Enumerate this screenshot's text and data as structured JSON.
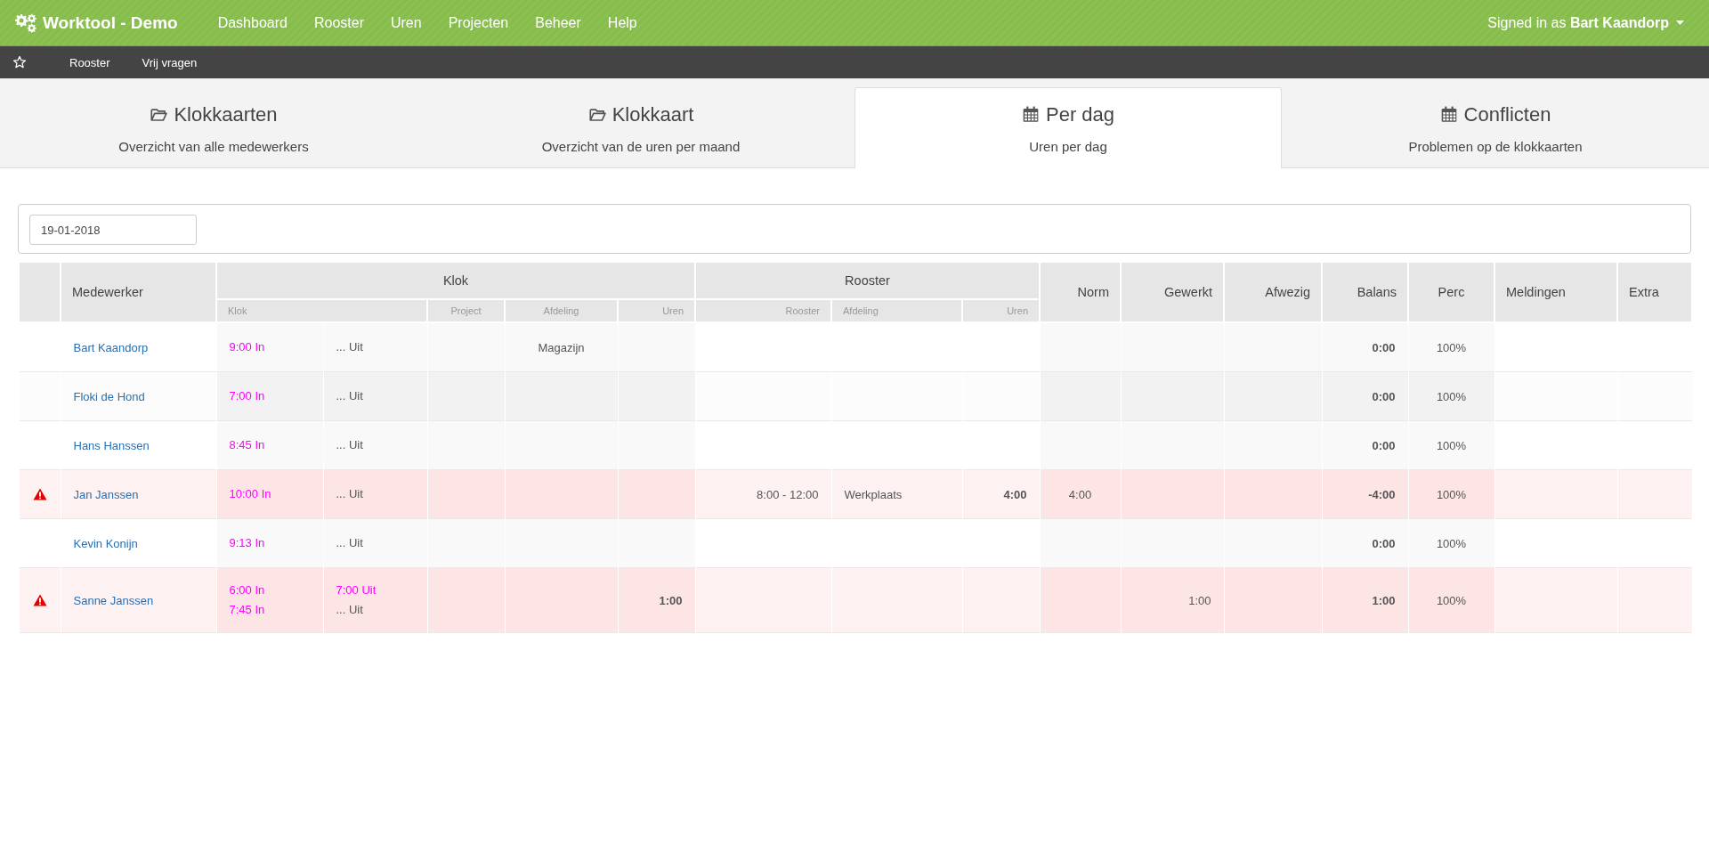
{
  "navbar": {
    "brand": "Worktool - Demo",
    "links": [
      "Dashboard",
      "Rooster",
      "Uren",
      "Projecten",
      "Beheer",
      "Help"
    ],
    "user": "Signed in as **Bart Kaandorp**"
  },
  "subnav": {
    "links": [
      "Rooster",
      "Vrij vragen"
    ]
  },
  "tabs": [
    {
      "title": "Klokkaarten",
      "subtitle": "Overzicht van alle medewerkers",
      "selected": false
    },
    {
      "title": "Klokkaart",
      "subtitle": "Overzicht van de uren per maand",
      "selected": false
    },
    {
      "title": "Per dag",
      "subtitle": "Uren per dag",
      "selected": true
    },
    {
      "title": "Conflicten",
      "subtitle": "Problemen op de klokkaarten",
      "selected": false
    }
  ],
  "date_field": {
    "value": "19-01-2018"
  },
  "table": {
    "columns": [
      {
        "label": "Medewerker"
      },
      {
        "label": "Klok",
        "children": [
          "Klok",
          "Project",
          "Afdeling",
          "Uren"
        ]
      },
      {
        "label": "Rooster",
        "children": [
          "Rooster",
          "Afdeling",
          "Uren"
        ]
      },
      {
        "label": "Norm"
      },
      {
        "label": "Gewerkt"
      },
      {
        "label": "Afwezig"
      },
      {
        "label": "Balans"
      },
      {
        "label": "Perc"
      },
      {
        "label": "Meldingen"
      },
      {
        "label": "Extra"
      }
    ],
    "rows": [
      {
        "conflict": false,
        "employee": "Bart Kaandorp",
        "clock_in": [
          {
            "text": "9:00 In",
            "kind": "time"
          }
        ],
        "clock_out": [
          {
            "text": "... Uit",
            "kind": "pending"
          }
        ],
        "afdeling": "Magazijn",
        "balans": "0:00",
        "perc": "100%"
      },
      {
        "conflict": false,
        "employee": "Floki de Hond",
        "clock_in": [
          {
            "text": "7:00 In",
            "kind": "time"
          }
        ],
        "clock_out": [
          {
            "text": "... Uit",
            "kind": "pending"
          }
        ],
        "balans": "0:00",
        "perc": "100%"
      },
      {
        "conflict": false,
        "employee": "Hans Hanssen",
        "clock_in": [
          {
            "text": "8:45 In",
            "kind": "time"
          }
        ],
        "clock_out": [
          {
            "text": "... Uit",
            "kind": "pending"
          }
        ],
        "balans": "0:00",
        "perc": "100%"
      },
      {
        "conflict": true,
        "employee": "Jan Janssen",
        "clock_in": [
          {
            "text": "10:00 In",
            "kind": "time"
          }
        ],
        "clock_out": [
          {
            "text": "... Uit",
            "kind": "pending"
          }
        ],
        "rooster": "8:00 - 12:00",
        "rooster_afdeling": "Werkplaats",
        "rooster_uren": "4:00",
        "norm": "4:00",
        "balans": "-4:00",
        "perc": "100%"
      },
      {
        "conflict": false,
        "employee": "Kevin Konijn",
        "clock_in": [
          {
            "text": "9:13 In",
            "kind": "time"
          }
        ],
        "clock_out": [
          {
            "text": "... Uit",
            "kind": "pending"
          }
        ],
        "balans": "0:00",
        "perc": "100%"
      },
      {
        "conflict": true,
        "employee": "Sanne Janssen",
        "clock_in": [
          {
            "text": "6:00 In",
            "kind": "time"
          },
          {
            "text": "7:45 In",
            "kind": "time"
          }
        ],
        "clock_out": [
          {
            "text": "7:00 Uit",
            "kind": "time"
          },
          {
            "text": "... Uit",
            "kind": "pending"
          }
        ],
        "uren": "1:00",
        "gewerkt": "1:00",
        "balans": "1:00",
        "perc": "100%"
      }
    ]
  }
}
